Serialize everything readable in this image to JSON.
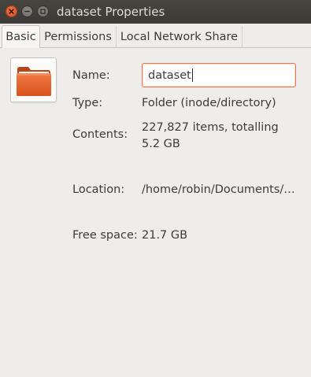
{
  "window": {
    "title": "dataset Properties"
  },
  "tabs": [
    {
      "label": "Basic",
      "active": true
    },
    {
      "label": "Permissions",
      "active": false
    },
    {
      "label": "Local Network Share",
      "active": false
    }
  ],
  "basic": {
    "folder_icon": "folder-icon",
    "name_label": "Name:",
    "name_value": "dataset",
    "type_label": "Type:",
    "type_value": "Folder (inode/directory)",
    "contents_label": "Contents:",
    "contents_value": "227,827 items, totalling 5.2 GB",
    "location_label": "Location:",
    "location_value": "/home/robin/Documents/…",
    "freespace_label": "Free space:",
    "freespace_value": "21.7 GB"
  },
  "colors": {
    "titlebar": "#3b3a36",
    "close_button": "#e05a2b",
    "focus_border": "#e9774a",
    "folder_orange": "#e35a22",
    "background": "#efedeb"
  }
}
